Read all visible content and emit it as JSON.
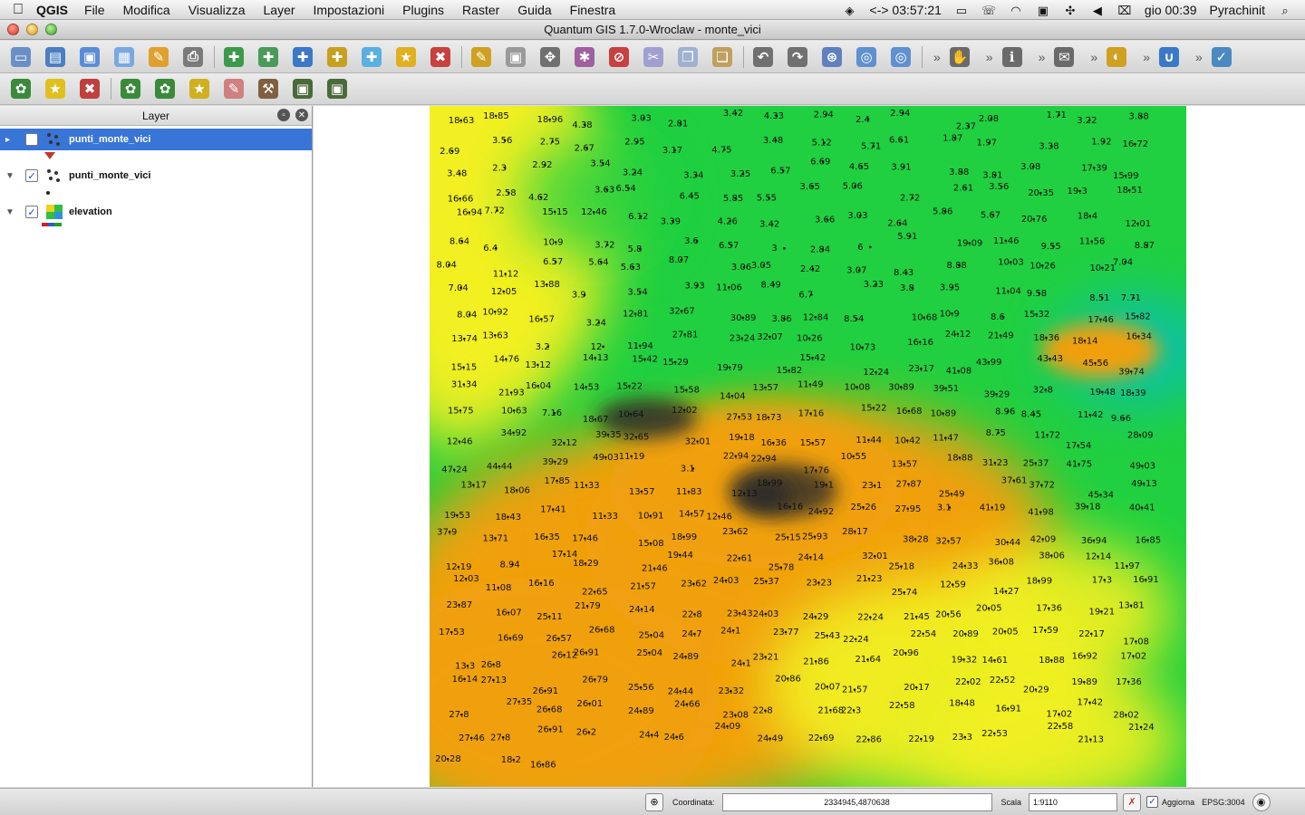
{
  "menubar": {
    "app_name": "QGIS",
    "items": [
      "File",
      "Modifica",
      "Visualizza",
      "Layer",
      "Impostazioni",
      "Plugins",
      "Raster",
      "Guida",
      "Finestra"
    ],
    "clock_timer": "<-> 03:57:21",
    "datetime": "gio 00:39",
    "user": "Pyrachinit"
  },
  "window": {
    "title": "Quantum GIS 1.7.0-Wroclaw - monte_vici"
  },
  "toolbar1": {
    "icons": [
      "new-project-icon",
      "open-project-icon",
      "save-project-icon",
      "save-as-icon",
      "new-print-composer-icon",
      "print-icon",
      "add-vector-layer-icon",
      "add-raster-layer-icon",
      "add-postgis-layer-icon",
      "add-spatialite-layer-icon",
      "add-wms-layer-icon",
      "new-vector-layer-icon",
      "remove-layer-icon",
      "toggle-editing-icon",
      "save-edits-icon",
      "move-feature-icon",
      "node-tool-icon",
      "delete-selected-icon",
      "cut-features-icon",
      "copy-features-icon",
      "paste-features-icon",
      "undo-icon",
      "redo-icon",
      "simplify-feature-icon",
      "add-ring-icon",
      "add-part-icon",
      "pan-icon",
      "identify-icon",
      "map-tips-icon",
      "north-arrow-icon",
      "label-icon",
      "spell-check-icon"
    ],
    "more": "»"
  },
  "toolbar2": {
    "icons": [
      "plugin-grass-icon",
      "plugin-star-icon",
      "plugin-remove-icon",
      "plugin-add-grass-icon",
      "plugin-new-grass-icon",
      "plugin-region-icon",
      "plugin-brush-icon",
      "plugin-tools-icon",
      "plugin-display-icon",
      "plugin-display2-icon"
    ]
  },
  "layer_panel": {
    "title": "Layer",
    "layers": [
      {
        "name": "punti_monte_vici",
        "checked": false,
        "selected": true,
        "expanded": true
      },
      {
        "name": "punti_monte_vici",
        "checked": true,
        "selected": false,
        "expanded": true
      },
      {
        "name": "elevation",
        "checked": true,
        "selected": false,
        "expanded": true
      }
    ],
    "check_mark": "✓",
    "expand_arrow": "▼"
  },
  "map": {
    "colors": {
      "low": "#00b8e8",
      "green": "#20d040",
      "yellow": "#f2f020",
      "orange": "#f0a010",
      "dark": "#2a2a2a"
    },
    "labels": [
      "18.63",
      "18.85",
      "18.96",
      "4.38",
      "3.03",
      "2.81",
      "3.42",
      "4.33",
      "2.94",
      "2.4",
      "2.94",
      "2.37",
      "2.08",
      "1.71",
      "3.22",
      "3.88",
      "2.69",
      "3.56",
      "2.75",
      "2.67",
      "2.95",
      "3.17",
      "4.75",
      "3.48",
      "5.12",
      "5.71",
      "6.61",
      "1.87",
      "1.97",
      "3.38",
      "1.92",
      "16.72",
      "3.48",
      "2.3",
      "2.92",
      "3.54",
      "3.24",
      "3.34",
      "3.25",
      "6.57",
      "6.69",
      "4.65",
      "3.91",
      "3.88",
      "3.81",
      "3.08",
      "17.39",
      "15.99",
      "16.66",
      "2.58",
      "4.62",
      "3.63",
      "6.54",
      "6.45",
      "5.85",
      "5.55",
      "3.65",
      "5.06",
      "2.72",
      "2.61",
      "3.56",
      "20.35",
      "19.3",
      "18.51",
      "16.94",
      "7.72",
      "15.15",
      "12.46",
      "6.12",
      "3.39",
      "4.26",
      "3.42",
      "3.66",
      "3.03",
      "2.64",
      "5.86",
      "5.67",
      "20.76",
      "18.4",
      "12.01",
      "8.64",
      "6.4",
      "10.9",
      "3.72",
      "5.8",
      "3.6",
      "6.57",
      "3",
      "2.84",
      "6",
      "5.91",
      "19.09",
      "11.46",
      "9.55",
      "11.56",
      "8.87",
      "8.04",
      "11.12",
      "6.57",
      "5.64",
      "5.63",
      "8.07",
      "3.06",
      "3.05",
      "2.42",
      "3.07",
      "8.43",
      "8.88",
      "10.03",
      "10.26",
      "10.21",
      "7.04",
      "7.04",
      "12.05",
      "13.88",
      "3.9",
      "3.54",
      "3.93",
      "11.06",
      "8.49",
      "6.7",
      "3.23",
      "3.8",
      "3.95",
      "11.04",
      "9.58",
      "8.51",
      "7.71",
      "8.04",
      "10.92",
      "16.57",
      "3.24",
      "12.81",
      "32.67",
      "30.89",
      "3.86",
      "12.84",
      "8.54",
      "10.68",
      "10.9",
      "8.6",
      "15.32",
      "17.46",
      "15.82",
      "13.74",
      "13.63",
      "3.2",
      "12",
      "11.94",
      "27.81",
      "23.24",
      "32.07",
      "10.26",
      "10.73",
      "16.16",
      "24.12",
      "21.49",
      "18.36",
      "18.14",
      "16.34",
      "15.15",
      "14.76",
      "13.12",
      "14.13",
      "15.42",
      "15.29",
      "19.79",
      "15.82",
      "15.42",
      "12.24",
      "23.17",
      "41.08",
      "43.99",
      "43.43",
      "45.56",
      "39.74",
      "31.34",
      "21.93",
      "16.04",
      "14.53",
      "15.22",
      "15.58",
      "14.04",
      "13.57",
      "11.49",
      "10.08",
      "30.89",
      "39.51",
      "39.29",
      "32.8",
      "19.48",
      "18.39",
      "15.75",
      "10.63",
      "7.16",
      "18.67",
      "10.64",
      "12.02",
      "27.53",
      "18.73",
      "17.16",
      "15.22",
      "16.68",
      "10.89",
      "8.96",
      "8.45",
      "11.42",
      "9.66",
      "12.46",
      "34.92",
      "32.12",
      "39.35",
      "32.65",
      "32.01",
      "19.18",
      "16.36",
      "15.57",
      "11.44",
      "10.42",
      "11.47",
      "8.75",
      "11.72",
      "17.54",
      "28.09",
      "47.24",
      "44.44",
      "39.29",
      "49.03",
      "11.19",
      "3.1",
      "22.94",
      "22.94",
      "17.76",
      "10.55",
      "13.57",
      "18.88",
      "31.23",
      "25.37",
      "41.75",
      "49.03",
      "13.17",
      "18.06",
      "17.85",
      "11.33",
      "13.57",
      "11.83",
      "12.13",
      "18.99",
      "19.1",
      "23.1",
      "27.87",
      "25.49",
      "37.61",
      "37.72",
      "45.34",
      "49.13",
      "19.53",
      "18.43",
      "17.41",
      "11.33",
      "10.91",
      "14.57",
      "12.46",
      "16.16",
      "24.92",
      "25.26",
      "27.95",
      "3.1",
      "41.19",
      "41.98",
      "39.18",
      "40.41",
      "37.9",
      "13.71",
      "16.35",
      "17.46",
      "15.08",
      "18.99",
      "23.62",
      "25.15",
      "25.93",
      "28.17",
      "38.28",
      "32.57",
      "30.44",
      "42.09",
      "36.94",
      "16.85",
      "12.19",
      "8.94",
      "17.14",
      "18.29",
      "21.46",
      "19.44",
      "22.61",
      "25.78",
      "24.14",
      "32.01",
      "25.18",
      "24.33",
      "36.08",
      "38.06",
      "12.14",
      "11.97",
      "12.03",
      "11.08",
      "16.16",
      "22.65",
      "21.57",
      "23.62",
      "24.03",
      "25.37",
      "23.23",
      "21.23",
      "25.74",
      "12.59",
      "14.27",
      "18.99",
      "17.3",
      "16.91",
      "23.87",
      "16.07",
      "25.11",
      "21.79",
      "24.14",
      "22.8",
      "23.43",
      "24.03",
      "24.29",
      "22.24",
      "21.45",
      "20.56",
      "20.05",
      "17.36",
      "19.21",
      "13.81",
      "17.53",
      "16.69",
      "26.57",
      "26.68",
      "25.04",
      "24.7",
      "24.1",
      "23.77",
      "25.43",
      "22.24",
      "22.54",
      "20.89",
      "20.05",
      "17.59",
      "22.17",
      "17.08",
      "13.3",
      "26.8",
      "26.12",
      "26.91",
      "25.04",
      "24.89",
      "24.1",
      "23.21",
      "21.86",
      "21.64",
      "20.96",
      "19.32",
      "14.61",
      "18.88",
      "16.92",
      "17.02",
      "16.14",
      "27.13",
      "26.91",
      "26.79",
      "25.56",
      "24.44",
      "23.32",
      "20.86",
      "20.07",
      "21.57",
      "20.17",
      "22.02",
      "22.52",
      "20.29",
      "19.89",
      "17.36",
      "27.8",
      "27.35",
      "26.68",
      "26.01",
      "24.89",
      "24.66",
      "23.08",
      "22.8",
      "21.68",
      "22.3",
      "22.58",
      "18.48",
      "16.91",
      "17.02",
      "17.42",
      "28.02",
      "27.46",
      "27.8",
      "26.91",
      "26.2",
      "24.4",
      "24.6",
      "24.09",
      "24.49",
      "22.69",
      "22.86",
      "22.19",
      "23.3",
      "22.53",
      "22.58",
      "21.13",
      "21.24",
      "20.28",
      "18.2",
      "16.86"
    ]
  },
  "statusbar": {
    "coord_label": "Coordinata:",
    "coord_value": "2334945,4870638",
    "scale_label": "Scala",
    "scale_value": "1:9110",
    "render_label": "Aggiorna",
    "crs": "EPSG:3004"
  }
}
